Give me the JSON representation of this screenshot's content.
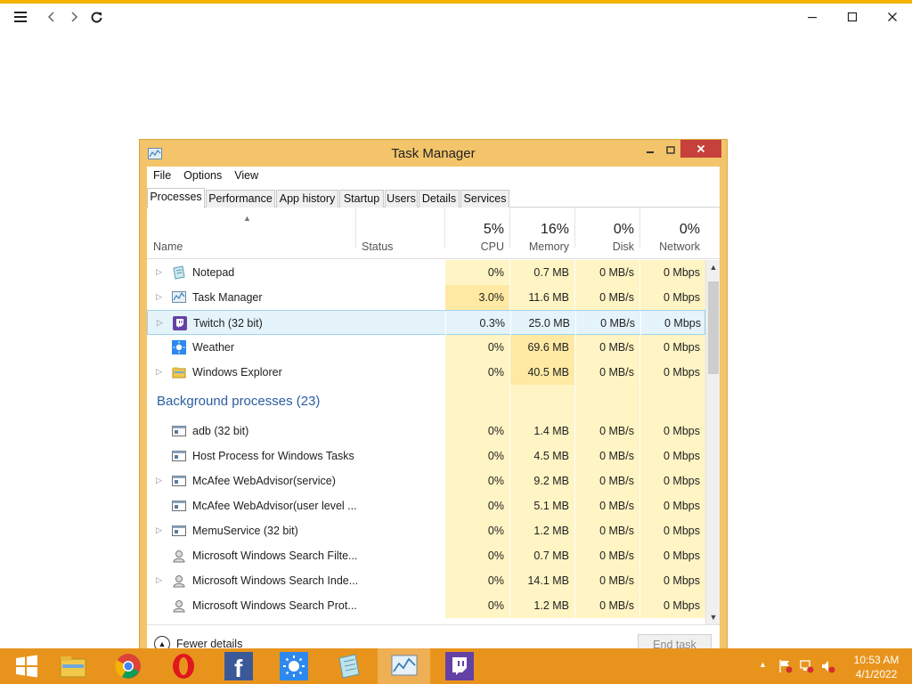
{
  "colors": {
    "accent_strip": "#f4b400",
    "taskbar": "#e8941c",
    "window_frame": "#f3c46a",
    "close_button": "#c7413c",
    "usage_light": "#fff4c4",
    "usage_medium": "#ffe9a3",
    "group_header": "#2a5d9f",
    "selected_row": "#e5f3fb"
  },
  "window": {
    "title": "Task Manager",
    "menu": [
      "File",
      "Options",
      "View"
    ],
    "tabs": [
      "Processes",
      "Performance",
      "App history",
      "Startup",
      "Users",
      "Details",
      "Services"
    ]
  },
  "columns": {
    "name": "Name",
    "status": "Status",
    "cpu": {
      "pct": "5%",
      "label": "CPU"
    },
    "memory": {
      "pct": "16%",
      "label": "Memory"
    },
    "disk": {
      "pct": "0%",
      "label": "Disk"
    },
    "network": {
      "pct": "0%",
      "label": "Network"
    }
  },
  "apps": [
    {
      "name": "Notepad",
      "icon": "notepad-icon",
      "expandable": true,
      "cpu": "0%",
      "memory": "0.7 MB",
      "disk": "0 MB/s",
      "network": "0 Mbps"
    },
    {
      "name": "Task Manager",
      "icon": "task-manager-icon",
      "expandable": true,
      "cpu": "3.0%",
      "memory": "11.6 MB",
      "disk": "0 MB/s",
      "network": "0 Mbps"
    },
    {
      "name": "Twitch (32 bit)",
      "icon": "twitch-icon",
      "expandable": true,
      "cpu": "0.3%",
      "memory": "25.0 MB",
      "disk": "0 MB/s",
      "network": "0 Mbps",
      "selected": true
    },
    {
      "name": "Weather",
      "icon": "weather-icon",
      "expandable": false,
      "cpu": "0%",
      "memory": "69.6 MB",
      "disk": "0 MB/s",
      "network": "0 Mbps"
    },
    {
      "name": "Windows Explorer",
      "icon": "folder-icon",
      "expandable": true,
      "cpu": "0%",
      "memory": "40.5 MB",
      "disk": "0 MB/s",
      "network": "0 Mbps"
    }
  ],
  "background_group": "Background processes (23)",
  "background": [
    {
      "name": "adb (32 bit)",
      "icon": "process-icon",
      "expandable": false,
      "cpu": "0%",
      "memory": "1.4 MB",
      "disk": "0 MB/s",
      "network": "0 Mbps"
    },
    {
      "name": "Host Process for Windows Tasks",
      "icon": "process-icon",
      "expandable": false,
      "cpu": "0%",
      "memory": "4.5 MB",
      "disk": "0 MB/s",
      "network": "0 Mbps"
    },
    {
      "name": "McAfee WebAdvisor(service)",
      "icon": "process-icon",
      "expandable": true,
      "cpu": "0%",
      "memory": "9.2 MB",
      "disk": "0 MB/s",
      "network": "0 Mbps"
    },
    {
      "name": "McAfee WebAdvisor(user level ...",
      "icon": "process-icon",
      "expandable": false,
      "cpu": "0%",
      "memory": "5.1 MB",
      "disk": "0 MB/s",
      "network": "0 Mbps"
    },
    {
      "name": "MemuService (32 bit)",
      "icon": "process-icon",
      "expandable": true,
      "cpu": "0%",
      "memory": "1.2 MB",
      "disk": "0 MB/s",
      "network": "0 Mbps"
    },
    {
      "name": "Microsoft Windows Search Filte...",
      "icon": "search-service-icon",
      "expandable": false,
      "cpu": "0%",
      "memory": "0.7 MB",
      "disk": "0 MB/s",
      "network": "0 Mbps"
    },
    {
      "name": "Microsoft Windows Search Inde...",
      "icon": "search-service-icon",
      "expandable": true,
      "cpu": "0%",
      "memory": "14.1 MB",
      "disk": "0 MB/s",
      "network": "0 Mbps"
    },
    {
      "name": "Microsoft Windows Search Prot...",
      "icon": "search-service-icon",
      "expandable": false,
      "cpu": "0%",
      "memory": "1.2 MB",
      "disk": "0 MB/s",
      "network": "0 Mbps"
    }
  ],
  "footer": {
    "fewer_details": "Fewer details",
    "end_task": "End task"
  },
  "taskbar": {
    "apps": [
      "start-icon",
      "file-explorer-icon",
      "chrome-icon",
      "opera-icon",
      "facebook-icon",
      "weather-icon",
      "notepad-icon",
      "task-manager-icon",
      "twitch-icon"
    ],
    "time": "10:53 AM",
    "date": "4/1/2022"
  }
}
